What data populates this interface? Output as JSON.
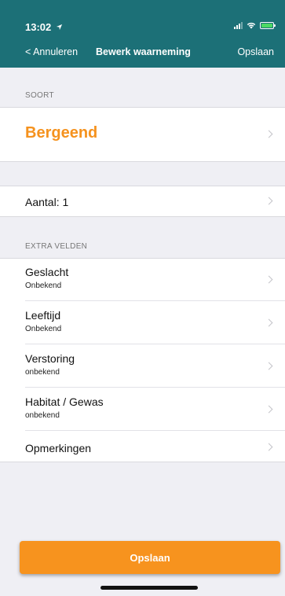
{
  "status_bar": {
    "time": "13:02",
    "location_icon": "location-arrow-icon",
    "signal_icon": "signal-icon",
    "wifi_icon": "wifi-icon",
    "battery_icon": "battery-icon",
    "battery_color": "#4cd964"
  },
  "nav": {
    "back_label": "< Annuleren",
    "title": "Bewerk waarneming",
    "save_label": "Opslaan",
    "bar_color": "#1c7077"
  },
  "species_section": {
    "header": "SOORT",
    "species": "Bergeend",
    "accent_color": "#f5921e"
  },
  "count": {
    "label": "Aantal: 1"
  },
  "extra_section": {
    "header": "EXTRA VELDEN",
    "items": [
      {
        "label": "Geslacht",
        "value": "Onbekend"
      },
      {
        "label": "Leeftijd",
        "value": "Onbekend"
      },
      {
        "label": "Verstoring",
        "value": "onbekend"
      },
      {
        "label": "Habitat / Gewas",
        "value": "onbekend"
      },
      {
        "label": "Opmerkingen",
        "value": ""
      }
    ]
  },
  "save_button": {
    "label": "Opslaan",
    "color": "#f7931e"
  }
}
